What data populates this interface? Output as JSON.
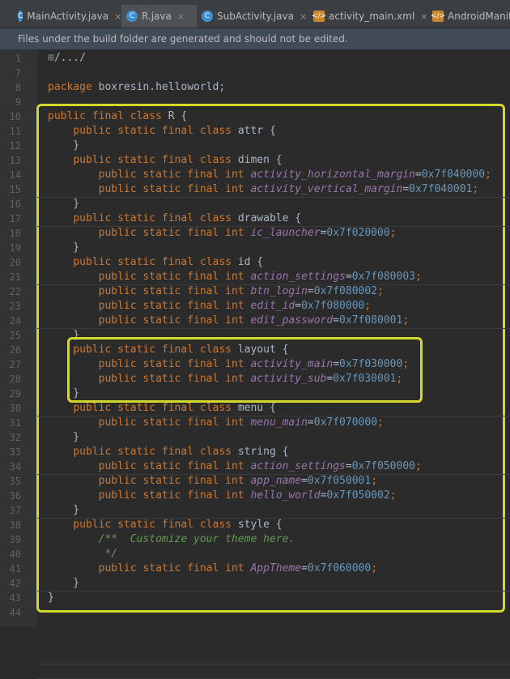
{
  "tabs": [
    {
      "label": "MainActivity.java",
      "icon": "C",
      "kind": "java",
      "active": false
    },
    {
      "label": "R.java",
      "icon": "C",
      "kind": "java",
      "active": true
    },
    {
      "label": "SubActivity.java",
      "icon": "C",
      "kind": "java",
      "active": false
    },
    {
      "label": "activity_main.xml",
      "icon": "</>",
      "kind": "xml",
      "active": false
    },
    {
      "label": "AndroidManifes",
      "icon": "</>",
      "kind": "xml",
      "active": false
    }
  ],
  "close_glyph": "×",
  "notice": "Files under the build folder are generated and should not be edited.",
  "lines": [
    {
      "n": "1",
      "tokens": [
        [
          "fold",
          "⊞"
        ],
        [
          "op",
          "/.../"
        ]
      ]
    },
    {
      "n": "7",
      "tokens": []
    },
    {
      "n": "8",
      "tokens": [
        [
          "kw",
          "package "
        ],
        [
          "op",
          "boxresin.helloworld;"
        ]
      ]
    },
    {
      "n": "9",
      "tokens": []
    },
    {
      "n": "10",
      "tokens": [
        [
          "kw",
          "public final class "
        ],
        [
          "op",
          "R {"
        ]
      ]
    },
    {
      "n": "11",
      "tokens": [
        [
          "op",
          "    "
        ],
        [
          "kw",
          "public static final class "
        ],
        [
          "op",
          "attr {"
        ]
      ]
    },
    {
      "n": "12",
      "tokens": [
        [
          "op",
          "    }"
        ]
      ]
    },
    {
      "n": "13",
      "tokens": [
        [
          "op",
          "    "
        ],
        [
          "kw",
          "public static final class "
        ],
        [
          "op",
          "dimen {"
        ]
      ]
    },
    {
      "n": "14",
      "tokens": [
        [
          "op",
          "        "
        ],
        [
          "kw",
          "public static final int "
        ],
        [
          "fld",
          "activity_horizontal_margin"
        ],
        [
          "op",
          "="
        ],
        [
          "num",
          "0x7f040000"
        ],
        [
          "kw",
          ";"
        ]
      ]
    },
    {
      "n": "15",
      "tokens": [
        [
          "op",
          "        "
        ],
        [
          "kw",
          "public static final int "
        ],
        [
          "fld",
          "activity_vertical_margin"
        ],
        [
          "op",
          "="
        ],
        [
          "num",
          "0x7f040001"
        ],
        [
          "kw",
          ";"
        ]
      ]
    },
    {
      "n": "16",
      "tokens": [
        [
          "op",
          "    }"
        ]
      ]
    },
    {
      "n": "17",
      "tokens": [
        [
          "op",
          "    "
        ],
        [
          "kw",
          "public static final class "
        ],
        [
          "op",
          "drawable {"
        ]
      ]
    },
    {
      "n": "18",
      "tokens": [
        [
          "op",
          "        "
        ],
        [
          "kw",
          "public static final int "
        ],
        [
          "fld",
          "ic_launcher"
        ],
        [
          "op",
          "="
        ],
        [
          "num",
          "0x7f020000"
        ],
        [
          "kw",
          ";"
        ]
      ]
    },
    {
      "n": "19",
      "tokens": [
        [
          "op",
          "    }"
        ]
      ]
    },
    {
      "n": "20",
      "tokens": [
        [
          "op",
          "    "
        ],
        [
          "kw",
          "public static final class "
        ],
        [
          "op",
          "id {"
        ]
      ]
    },
    {
      "n": "21",
      "tokens": [
        [
          "op",
          "        "
        ],
        [
          "kw",
          "public static final int "
        ],
        [
          "fld",
          "action_settings"
        ],
        [
          "op",
          "="
        ],
        [
          "num",
          "0x7f080003"
        ],
        [
          "kw",
          ";"
        ]
      ]
    },
    {
      "n": "22",
      "tokens": [
        [
          "op",
          "        "
        ],
        [
          "kw",
          "public static final int "
        ],
        [
          "fld",
          "btn_login"
        ],
        [
          "op",
          "="
        ],
        [
          "num",
          "0x7f080002"
        ],
        [
          "kw",
          ";"
        ]
      ]
    },
    {
      "n": "23",
      "tokens": [
        [
          "op",
          "        "
        ],
        [
          "kw",
          "public static final int "
        ],
        [
          "fld",
          "edit_id"
        ],
        [
          "op",
          "="
        ],
        [
          "num",
          "0x7f080000"
        ],
        [
          "kw",
          ";"
        ]
      ]
    },
    {
      "n": "24",
      "tokens": [
        [
          "op",
          "        "
        ],
        [
          "kw",
          "public static final int "
        ],
        [
          "fld",
          "edit_password"
        ],
        [
          "op",
          "="
        ],
        [
          "num",
          "0x7f080001"
        ],
        [
          "kw",
          ";"
        ]
      ]
    },
    {
      "n": "25",
      "tokens": [
        [
          "op",
          "    }"
        ]
      ]
    },
    {
      "n": "26",
      "tokens": [
        [
          "op",
          "    "
        ],
        [
          "kw",
          "public static final class "
        ],
        [
          "op",
          "layout {"
        ]
      ]
    },
    {
      "n": "27",
      "tokens": [
        [
          "op",
          "        "
        ],
        [
          "kw",
          "public static final int "
        ],
        [
          "fld",
          "activity_main"
        ],
        [
          "op",
          "="
        ],
        [
          "num",
          "0x7f030000"
        ],
        [
          "kw",
          ";"
        ]
      ]
    },
    {
      "n": "28",
      "tokens": [
        [
          "op",
          "        "
        ],
        [
          "kw",
          "public static final int "
        ],
        [
          "fld",
          "activity_sub"
        ],
        [
          "op",
          "="
        ],
        [
          "num",
          "0x7f030001"
        ],
        [
          "kw",
          ";"
        ]
      ]
    },
    {
      "n": "29",
      "tokens": [
        [
          "op",
          "    }"
        ]
      ]
    },
    {
      "n": "30",
      "tokens": [
        [
          "op",
          "    "
        ],
        [
          "kw",
          "public static final class "
        ],
        [
          "op",
          "menu {"
        ]
      ]
    },
    {
      "n": "31",
      "tokens": [
        [
          "op",
          "        "
        ],
        [
          "kw",
          "public static final int "
        ],
        [
          "fld",
          "menu_main"
        ],
        [
          "op",
          "="
        ],
        [
          "num",
          "0x7f070000"
        ],
        [
          "kw",
          ";"
        ]
      ]
    },
    {
      "n": "32",
      "tokens": [
        [
          "op",
          "    }"
        ]
      ]
    },
    {
      "n": "33",
      "tokens": [
        [
          "op",
          "    "
        ],
        [
          "kw",
          "public static final class "
        ],
        [
          "op",
          "string {"
        ]
      ]
    },
    {
      "n": "34",
      "tokens": [
        [
          "op",
          "        "
        ],
        [
          "kw",
          "public static final int "
        ],
        [
          "fld",
          "action_settings"
        ],
        [
          "op",
          "="
        ],
        [
          "num",
          "0x7f050000"
        ],
        [
          "kw",
          ";"
        ]
      ]
    },
    {
      "n": "35",
      "tokens": [
        [
          "op",
          "        "
        ],
        [
          "kw",
          "public static final int "
        ],
        [
          "fld",
          "app_name"
        ],
        [
          "op",
          "="
        ],
        [
          "num",
          "0x7f050001"
        ],
        [
          "kw",
          ";"
        ]
      ]
    },
    {
      "n": "36",
      "tokens": [
        [
          "op",
          "        "
        ],
        [
          "kw",
          "public static final int "
        ],
        [
          "fld",
          "hello_world"
        ],
        [
          "op",
          "="
        ],
        [
          "num",
          "0x7f050002"
        ],
        [
          "kw",
          ";"
        ]
      ]
    },
    {
      "n": "37",
      "tokens": [
        [
          "op",
          "    }"
        ]
      ]
    },
    {
      "n": "38",
      "tokens": [
        [
          "op",
          "    "
        ],
        [
          "kw",
          "public static final class "
        ],
        [
          "op",
          "style {"
        ]
      ]
    },
    {
      "n": "39",
      "tokens": [
        [
          "op",
          "        "
        ],
        [
          "cmt",
          "/**  Customize your theme here."
        ]
      ]
    },
    {
      "n": "40",
      "tokens": [
        [
          "op",
          "         "
        ],
        [
          "cmt",
          "*/"
        ]
      ]
    },
    {
      "n": "41",
      "tokens": [
        [
          "op",
          "        "
        ],
        [
          "kw",
          "public static final int "
        ],
        [
          "fld",
          "AppTheme"
        ],
        [
          "op",
          "="
        ],
        [
          "num",
          "0x7f060000"
        ],
        [
          "kw",
          ";"
        ]
      ]
    },
    {
      "n": "42",
      "tokens": [
        [
          "op",
          "    }"
        ]
      ]
    },
    {
      "n": "43",
      "tokens": [
        [
          "op",
          "}"
        ]
      ]
    },
    {
      "n": "44",
      "tokens": []
    }
  ],
  "colors": {
    "keyword": "#cc7832",
    "field": "#9876aa",
    "number": "#6897bb",
    "comment": "#629755",
    "highlight": "#d4d82a"
  }
}
